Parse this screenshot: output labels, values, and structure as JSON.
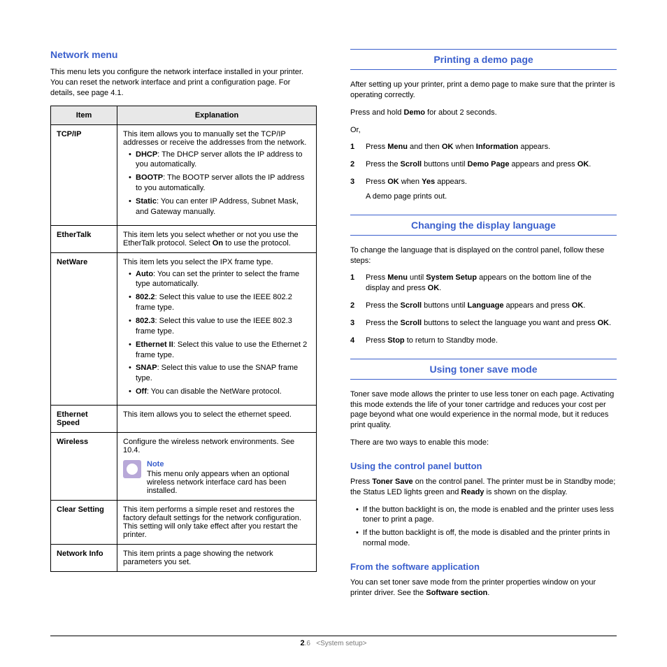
{
  "left": {
    "heading": "Network menu",
    "intro": "This menu lets you configure the network interface installed in your printer. You can reset the network interface and print a configuration page. For details, see page 4.1.",
    "th_item": "Item",
    "th_expl": "Explanation",
    "rows": {
      "tcpip": {
        "item": "TCP/IP",
        "intro": "This item allows you to manually set the TCP/IP addresses or receive the addresses from the network.",
        "b1a": "DHCP",
        "b1b": ": The DHCP server allots the IP address to you automatically.",
        "b2a": "BOOTP",
        "b2b": ": The BOOTP server allots the IP address to you automatically.",
        "b3a": "Static",
        "b3b": ": You can enter IP Address, Subnet Mask, and Gateway manually."
      },
      "ethertalk": {
        "item": "EtherTalk",
        "t1": "This item lets you select whether or not you use the EtherTalk protocol. Select ",
        "on": "On",
        "t2": " to use the protocol."
      },
      "netware": {
        "item": "NetWare",
        "intro": "This item lets you select the IPX frame type.",
        "b1a": "Auto",
        "b1b": ": You can set the printer to select the frame type automatically.",
        "b2a": "802.2",
        "b2b": ": Select this value to use the IEEE 802.2 frame type.",
        "b3a": "802.3",
        "b3b": ": Select this value to use the IEEE 802.3 frame type.",
        "b4a": "Ethernet II",
        "b4b": ": Select this value to use the Ethernet 2 frame type.",
        "b5a": "SNAP",
        "b5b": ": Select this value to use the SNAP frame type.",
        "b6a": "Off",
        "b6b": ": You can disable the NetWare protocol."
      },
      "espeed": {
        "item": "Ethernet Speed",
        "text": "This item allows you to select the ethernet speed."
      },
      "wireless": {
        "item": "Wireless",
        "t1": "Configure the wireless network environments. See 10.4.",
        "note_label": "Note",
        "note_text": "This menu only appears when an optional wireless network interface card has been installed."
      },
      "clear": {
        "item": "Clear Setting",
        "text": "This item performs a simple reset and restores the factory default settings for the network configuration. This setting will only take effect after you restart the printer."
      },
      "ninfo": {
        "item": "Network Info",
        "text": "This item prints a page showing the network parameters you set."
      }
    }
  },
  "right": {
    "s1": {
      "title": "Printing a demo page",
      "p1": "After setting up your printer, print a demo page to make sure that the printer is operating correctly.",
      "p2a": "Press and hold ",
      "demo": "Demo",
      "p2b": " for about 2 seconds.",
      "or": "Or,",
      "l1a": "Press ",
      "menu": "Menu",
      "l1b": " and then ",
      "ok": "OK",
      "l1c": " when ",
      "info": "Information",
      "l1d": " appears.",
      "l2a": "Press the ",
      "scroll": "Scroll",
      "l2b": " buttons until ",
      "dp": "Demo Page",
      "l2c": " appears and press ",
      "l2d": ".",
      "l3a": "Press ",
      "l3b": " when ",
      "yes": "Yes",
      "l3c": " appears.",
      "sub": "A demo page prints out."
    },
    "s2": {
      "title": "Changing the display language",
      "p1": "To change the language that is displayed on the control panel, follow these steps:",
      "l1a": "Press ",
      "menu": "Menu",
      "l1b": " until ",
      "ss": "System Setup",
      "l1c": " appears on the bottom line of the display and press ",
      "ok": "OK",
      "l1d": ".",
      "l2a": "Press the ",
      "scroll": "Scroll",
      "l2b": " buttons until ",
      "lang": "Language",
      "l2c": " appears and press ",
      "l2d": ".",
      "l3a": "Press the ",
      "l3b": " buttons to select the language you want and press ",
      "l3c": ".",
      "l4a": "Press ",
      "stop": "Stop",
      "l4b": " to return to Standby mode."
    },
    "s3": {
      "title": "Using toner save mode",
      "p1": "Toner save mode allows the printer to use less toner on each page. Activating this mode extends the life of your toner cartridge and reduces your cost per page beyond what one would experience in the normal mode, but it reduces print quality.",
      "p2": "There are two ways to enable this mode:",
      "sub1": "Using the control panel button",
      "p3a": "Press ",
      "ts": "Toner Save",
      "p3b": " on the control panel. The printer must be in Standby mode; the Status LED lights green and ",
      "ready": "Ready",
      "p3c": " is shown on the display.",
      "b1": "If the button backlight is on, the mode is enabled and the printer uses less toner to print a page.",
      "b2": "If the button backlight is off, the mode is disabled and the printer prints in normal mode.",
      "sub2": "From the software application",
      "p4a": "You can set toner save mode from the printer properties window on your printer driver. See the ",
      "sw": "Software section",
      "p4b": "."
    }
  },
  "footer": {
    "pn": "2",
    "pn2": ".6",
    "label": "<System setup>"
  }
}
